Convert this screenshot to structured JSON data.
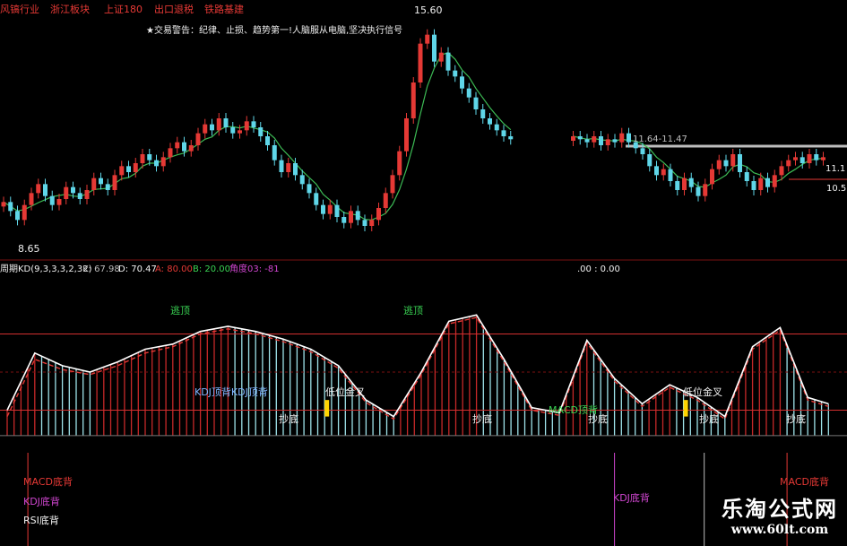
{
  "header": {
    "sectors": [
      "风镐行业",
      "浙江板块",
      "上证180",
      "出口退税",
      "铁路基建"
    ],
    "warning": "★交易警告：纪律、止损、趋势第一!人脑服从电脑,坚决执行信号"
  },
  "price_panel": {
    "high_label": "15.60",
    "low_label": "8.65",
    "range_label": "11.64-11.47",
    "right_label_1": "11.1",
    "right_label_2": "10.5"
  },
  "indicator_header": {
    "name": "周期KD(9,3,3,3,2,32)",
    "k": "K: 67.98",
    "d": "D: 70.47",
    "a": "A: 80.00",
    "b": "B: 20.00",
    "angle": "角度03: -81",
    "extra": ".00 : 0.00"
  },
  "signals": {
    "top_escape": "逃顶",
    "bottom_catch": "抄底",
    "kdj_top_div": "KDJ顶背KDJ顶背",
    "low_golden_cross": "低位金叉",
    "macd_top_div": "MACD顶背"
  },
  "bottom_labels": {
    "macd_bottom": "MACD底背",
    "kdj_bottom": "KDJ底背",
    "rsi_bottom": "RSI底背"
  },
  "watermark": {
    "title": "乐淘公式网",
    "url": "www.60lt.com"
  },
  "colors": {
    "up": "#e53935",
    "down": "#5fd6e8",
    "ma": "#3cba54",
    "k_line": "#ffffff",
    "d_line": "#e53935",
    "hist_up": "#c62828",
    "hist_down": "#9ee3ea",
    "level": "#d32f2f",
    "signal": "#ffd400"
  },
  "chart_data": [
    {
      "type": "candlestick",
      "title": "",
      "ylabel": "",
      "ylim": [
        8.2,
        16.0
      ],
      "segments": [
        {
          "start": 0,
          "closes": [
            9.6,
            9.3,
            9.0,
            9.5,
            9.9,
            10.2,
            9.8,
            9.5,
            9.7,
            10.1,
            9.9,
            9.7,
            10.0,
            10.4,
            10.2,
            10.0,
            10.5,
            10.8,
            10.6,
            10.9,
            11.2,
            11.0,
            10.8,
            11.1,
            11.4,
            11.6,
            11.3,
            11.5,
            11.9,
            12.2,
            12.0,
            12.4,
            12.1,
            11.9,
            12.0,
            12.3,
            12.1,
            11.8,
            11.5,
            11.0,
            10.6,
            10.9,
            10.5,
            10.2,
            9.9,
            9.5,
            9.2,
            9.5,
            9.1,
            8.9,
            9.3,
            9.0,
            8.8,
            9.0,
            9.4,
            9.9,
            10.5,
            11.3,
            12.4,
            13.6,
            14.9,
            15.2,
            14.3,
            14.6,
            14.0,
            13.8,
            13.4,
            13.1,
            12.7,
            12.4,
            12.2,
            12.0,
            11.8,
            11.7
          ]
        },
        {
          "start": 82,
          "closes": [
            11.8,
            11.7,
            11.6,
            11.8,
            11.5,
            11.7,
            11.6,
            11.9,
            11.6,
            11.4,
            11.2,
            10.8,
            10.5,
            10.7,
            10.3,
            10.0,
            10.4,
            10.1,
            9.8,
            10.2,
            10.7,
            11.0,
            10.8,
            11.2,
            10.6,
            10.3,
            10.0,
            10.4,
            10.1,
            10.5,
            10.8,
            11.0,
            11.1,
            10.9,
            11.2,
            11.0,
            11.1
          ]
        }
      ]
    },
    {
      "type": "line",
      "title": "周期KD(9,3,3,3,2,32)",
      "ylim": [
        -10,
        110
      ],
      "levels": [
        80,
        20
      ],
      "series": [
        {
          "name": "K",
          "x": [
            0,
            4,
            8,
            12,
            16,
            20,
            24,
            28,
            32,
            36,
            40,
            44,
            48,
            52,
            56,
            60,
            64,
            68,
            72,
            76,
            80,
            84,
            88,
            92,
            96,
            100,
            104,
            108,
            112,
            116,
            119
          ],
          "values": [
            20,
            65,
            55,
            50,
            58,
            68,
            72,
            82,
            86,
            82,
            76,
            68,
            55,
            28,
            15,
            50,
            90,
            95,
            60,
            22,
            18,
            75,
            45,
            25,
            40,
            30,
            15,
            70,
            85,
            30,
            25
          ]
        },
        {
          "name": "D",
          "x": [
            0,
            4,
            8,
            12,
            16,
            20,
            24,
            28,
            32,
            36,
            40,
            44,
            48,
            52,
            56,
            60,
            64,
            68,
            72,
            76,
            80,
            84,
            88,
            92,
            96,
            100,
            104,
            108,
            112,
            116,
            119
          ],
          "values": [
            15,
            60,
            52,
            48,
            55,
            65,
            70,
            80,
            84,
            80,
            74,
            66,
            53,
            26,
            13,
            48,
            88,
            93,
            58,
            20,
            16,
            73,
            43,
            23,
            38,
            28,
            13,
            68,
            83,
            28,
            23
          ]
        }
      ]
    }
  ]
}
